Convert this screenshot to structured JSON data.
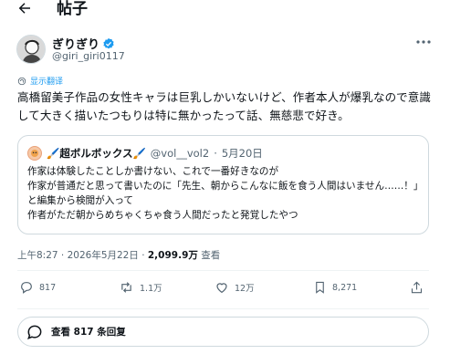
{
  "header": {
    "title": "帖子"
  },
  "post": {
    "author_name": "ぎりぎり",
    "author_handle": "@giri_giri0117",
    "translate_label": "显示翻译",
    "text": "高橋留美子作品の女性キャラは巨乳しかいないけど、作者本人が爆乳なので意識して大きく描いたつもりは特に無かったって話、無慈悲で好き。",
    "quote": {
      "name": "🖌️超ボルボックス🖌️",
      "handle": "@vol__vol2",
      "sep": "·",
      "date": "5月20日",
      "text": "作家は体験したことしか書けない、これで一番好きなのが\n作家が普通だと思って書いたのに「先生、朝からこんなに飯を食う人間はいません……！」と編集から検閲が入って\n作者がただ朝からめちゃくちゃ食う人間だったと発覚したやつ"
    },
    "meta": {
      "time_date": "上午8:27 · 2026年5月22日 · ",
      "views_count": "2,099.9万",
      "views_label": " 查看"
    },
    "actions": {
      "replies": "817",
      "reposts": "1.1万",
      "likes": "12万",
      "bookmarks": "8,271"
    },
    "view_replies": "查看 817 条回复"
  },
  "colors": {
    "accent": "#1d9bf0",
    "text": "#0f1419",
    "muted": "#536471",
    "border": "#cfd9de"
  },
  "icons": [
    "back-arrow-icon",
    "verified-badge-icon",
    "more-icon",
    "translate-icon",
    "reply-icon",
    "repost-icon",
    "like-icon",
    "bookmark-icon",
    "share-icon",
    "chat-bubble-icon"
  ]
}
